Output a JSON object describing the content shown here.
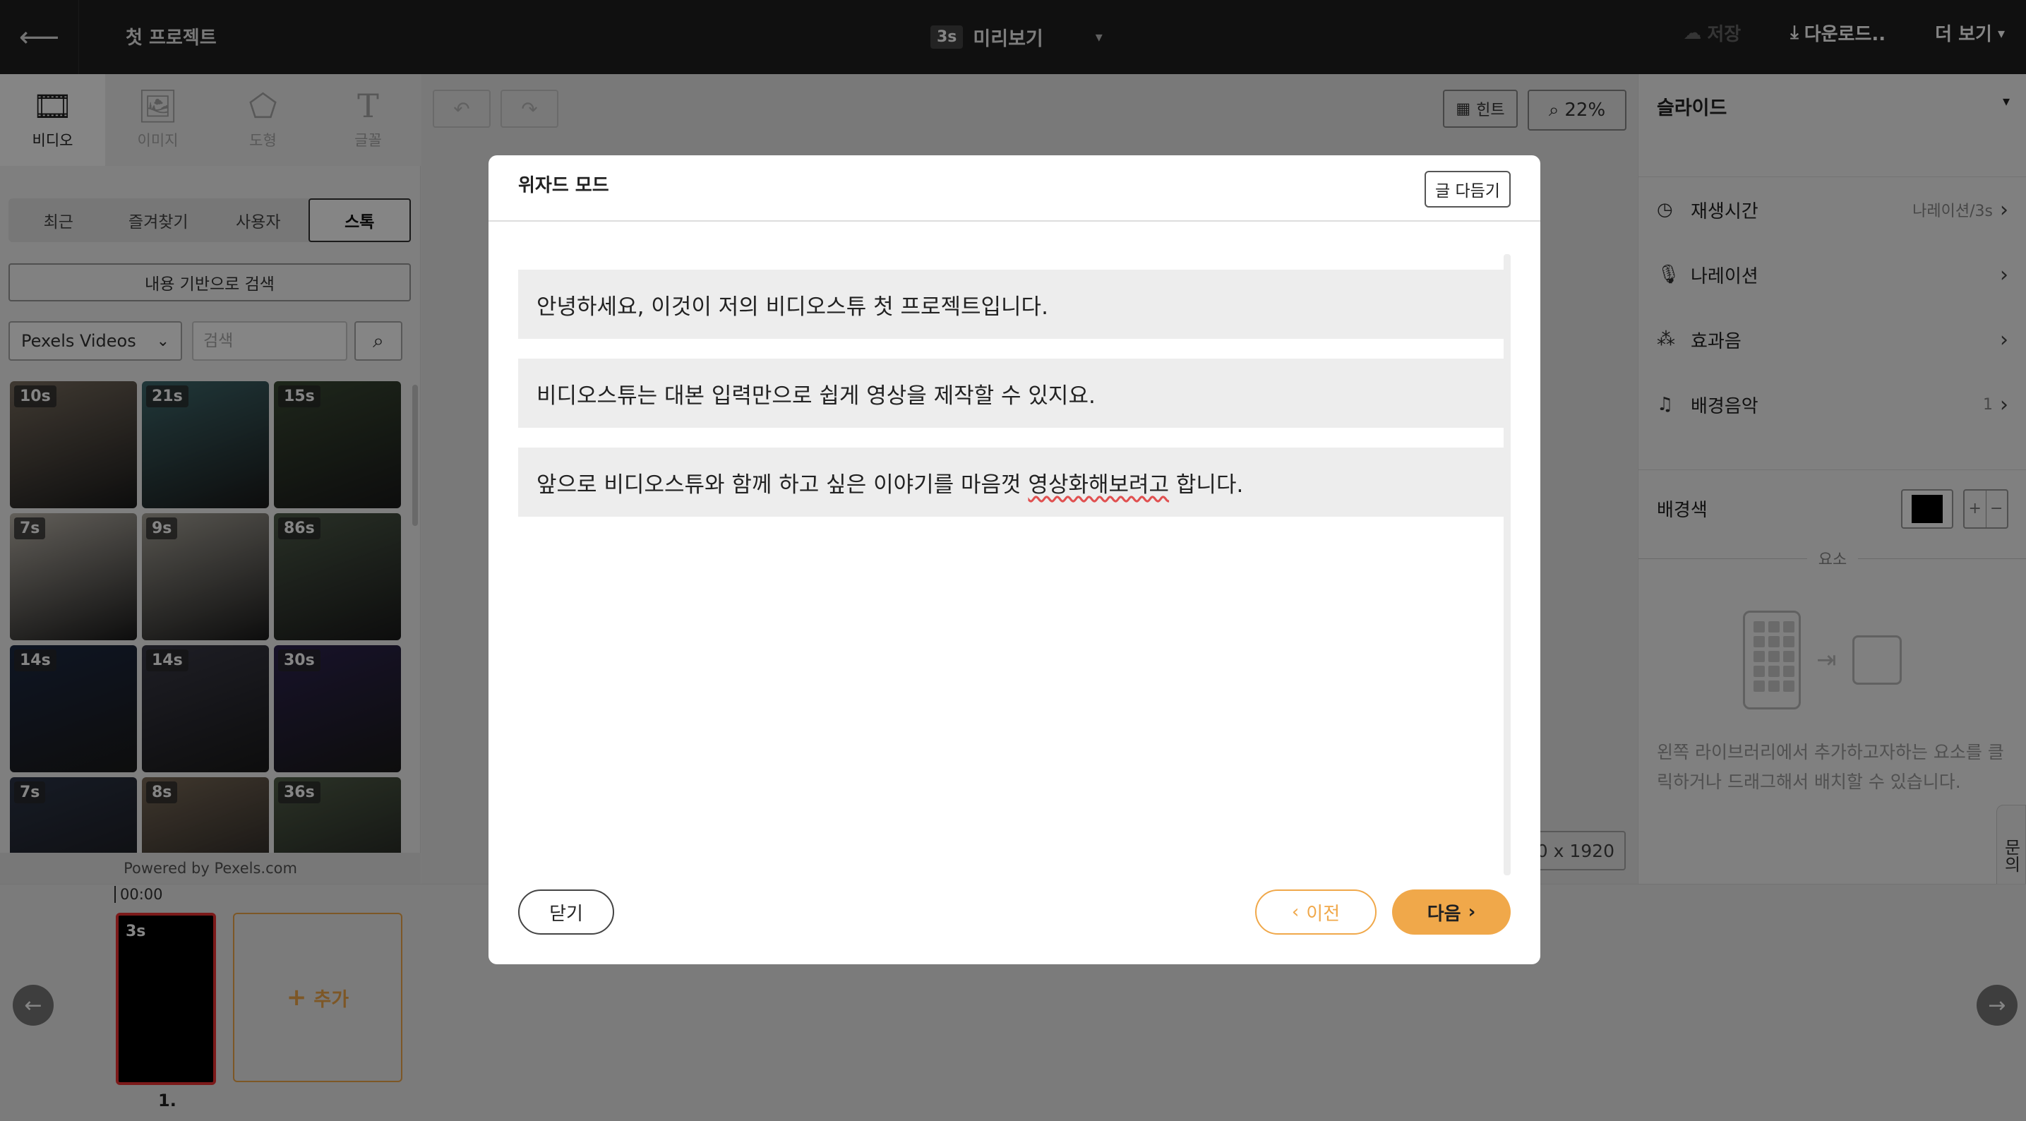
{
  "topbar": {
    "back_icon": "arrow-left-icon",
    "project_title": "첫 프로젝트",
    "preview_badge": "3s",
    "preview_label": "미리보기",
    "preview_caret": "▾",
    "save_label": "저장",
    "download_label": "다운로드..",
    "more_label": "더 보기"
  },
  "left": {
    "type_tabs": [
      {
        "label": "비디오",
        "glyph": "🎞",
        "icon": "film-icon"
      },
      {
        "label": "이미지",
        "glyph": "🖼",
        "icon": "image-icon"
      },
      {
        "label": "도형",
        "glyph": "⬠",
        "icon": "pentagon-icon"
      },
      {
        "label": "글꼴",
        "glyph": "T",
        "icon": "text-icon"
      }
    ],
    "source_tabs": [
      "최근",
      "즐겨찾기",
      "사용자",
      "스톡"
    ],
    "content_search_label": "내용 기반으로 검색",
    "provider_label": "Pexels Videos",
    "search_placeholder": "검색",
    "thumbnails": [
      {
        "duration": "10s",
        "color": "#7a6e60"
      },
      {
        "duration": "21s",
        "color": "#3f6a6e"
      },
      {
        "duration": "15s",
        "color": "#3a4a34"
      },
      {
        "duration": "7s",
        "color": "#bcb6ac"
      },
      {
        "duration": "9s",
        "color": "#a8a49a"
      },
      {
        "duration": "86s",
        "color": "#4e5c4a"
      },
      {
        "duration": "14s",
        "color": "#1c2a44"
      },
      {
        "duration": "14s",
        "color": "#3a3a48"
      },
      {
        "duration": "30s",
        "color": "#2e2450"
      },
      {
        "duration": "7s",
        "color": "#2c3448"
      },
      {
        "duration": "8s",
        "color": "#7a6a58"
      },
      {
        "duration": "36s",
        "color": "#52604a"
      }
    ],
    "powered_by": "Powered by Pexels.com"
  },
  "canvas": {
    "hint_label": "힌트",
    "zoom_label": "22%",
    "size_label": "30 x 1920"
  },
  "right": {
    "title": "슬라이드",
    "rows": [
      {
        "label": "재생시간",
        "value": "나레이션/3s",
        "icon": "clock-icon",
        "glyph": "◷"
      },
      {
        "label": "나레이션",
        "value": "",
        "icon": "microphone-icon",
        "glyph": "🎙"
      },
      {
        "label": "효과음",
        "value": "",
        "icon": "soundwave-icon",
        "glyph": "⁂"
      },
      {
        "label": "배경음악",
        "value": "1",
        "icon": "music-note-icon",
        "glyph": "♫"
      }
    ],
    "bg_label": "배경색",
    "bg_color": "#000000",
    "element_divider": "요소",
    "element_help": "왼쪽 라이브러리에서 추가하고자하는 요소를 클릭하거나 드래그해서 배치할 수 있습니다.",
    "inquiry_label": "문의"
  },
  "timeline": {
    "time": "00:00",
    "clip_duration": "3s",
    "clip_number": "1.",
    "add_label": "추가"
  },
  "modal": {
    "title": "위자드 모드",
    "polish_label": "글 다듬기",
    "lines": [
      {
        "text": "안녕하세요, 이것이 저의 비디오스튜 첫 프로젝트입니다."
      },
      {
        "text": "비디오스튜는 대본 입력만으로 쉽게 영상을 제작할 수 있지요."
      },
      {
        "before": "앞으로 비디오스튜와 함께 하고 싶은 이야기를 마음껏 ",
        "flag": "영상화해보려고",
        "after": " 합니다."
      }
    ],
    "close_label": "닫기",
    "prev_label": "이전",
    "next_label": "다음"
  }
}
